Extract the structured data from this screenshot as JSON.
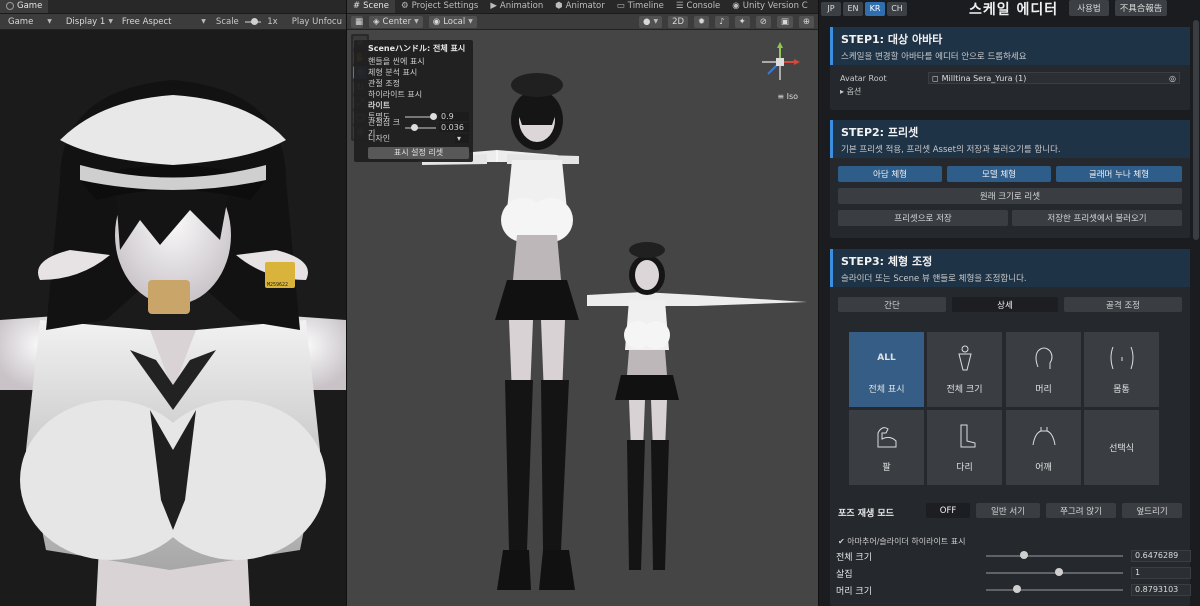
{
  "game": {
    "tab_label": "Game",
    "display_mode": "Game",
    "display": "Display 1",
    "aspect": "Free Aspect",
    "scale_label": "Scale",
    "scale_value": "1x",
    "play_label": "Play Unfocu",
    "badge_code": "M259622"
  },
  "scene": {
    "tabs": [
      "Scene",
      "Project Settings",
      "Animation",
      "Animator",
      "Timeline",
      "Console",
      "Unity Version C"
    ],
    "pivot": "Center",
    "space": "Local",
    "mode_2d": "2D",
    "iso": "Iso",
    "overlay": {
      "title": "Sceneハンドル: 전체 표시",
      "rows": [
        "핸들을 씬에 표시",
        "체형 분석 표시",
        "관절 조정",
        "하이라이트 표시"
      ],
      "section": "라이트",
      "opacity_label": "투명도",
      "opacity_value": "0.9",
      "joint_label": "관절점 크기",
      "joint_value": "0.036",
      "design_label": "디자인",
      "reset_label": "표시 설정 리셋"
    }
  },
  "editor": {
    "langs": [
      "JP",
      "EN",
      "KR",
      "CH"
    ],
    "active_lang": "KR",
    "title": "스케일 에디터",
    "usage_button": "사용법",
    "report_button": "不具合報告",
    "step1": {
      "title": "STEP1: 대상 아바타",
      "desc": "스케일을 변경할 아바타를 에디터 안으로 드롭하세요",
      "avatar_label": "Avatar Root",
      "avatar_value": "Milltina Sera_Yura (1)",
      "options": "옵션"
    },
    "step2": {
      "title": "STEP2: 프리셋",
      "desc": "기본 프리셋 적용, 프리셋 Asset의 저장과 불러오기를 합니다.",
      "presets": [
        "아담 체형",
        "모델 체형",
        "글래머 누나 체형"
      ],
      "reset": "원래 크기로 리셋",
      "save": "프리셋으로 저장",
      "load": "저장한 프리셋에서 불러오기"
    },
    "step3": {
      "title": "STEP3: 체형 조정",
      "desc": "슬라이더 또는 Scene 뷰 핸들로 체형을 조정합니다.",
      "modes": [
        "간단",
        "상세",
        "골격 조정"
      ],
      "active_mode": "상세",
      "tiles": [
        {
          "top": "ALL",
          "label": "전체 표시",
          "icon": "all-icon"
        },
        {
          "top": "",
          "label": "전체 크기",
          "icon": "body-icon"
        },
        {
          "top": "",
          "label": "머리",
          "icon": "head-icon"
        },
        {
          "top": "",
          "label": "몸통",
          "icon": "torso-icon"
        },
        {
          "top": "",
          "label": "팔",
          "icon": "arm-icon"
        },
        {
          "top": "",
          "label": "다리",
          "icon": "leg-icon"
        },
        {
          "top": "",
          "label": "어깨",
          "icon": "shoulder-icon"
        },
        {
          "top": "",
          "label": "선택식",
          "icon": ""
        }
      ],
      "pose_label": "포즈 재생 모드",
      "pose_options": [
        "OFF",
        "일반 서기",
        "쭈그려 앉기",
        "엎드리기"
      ],
      "active_pose": "OFF",
      "highlight_toggle": "아마추어/슬라이더 하이라이트 표시",
      "sliders": [
        {
          "label": "전체 크기",
          "value": "0.6476289",
          "level": 0.25
        },
        {
          "label": "살집",
          "value": "1",
          "level": 0.5
        },
        {
          "label": "머리 크기",
          "value": "0.8793103",
          "level": 0.2
        }
      ]
    }
  },
  "colors": {
    "accent": "#3b8ee0",
    "active_blue": "#2f5d8a",
    "panel_bg": "#1a1c1f"
  }
}
